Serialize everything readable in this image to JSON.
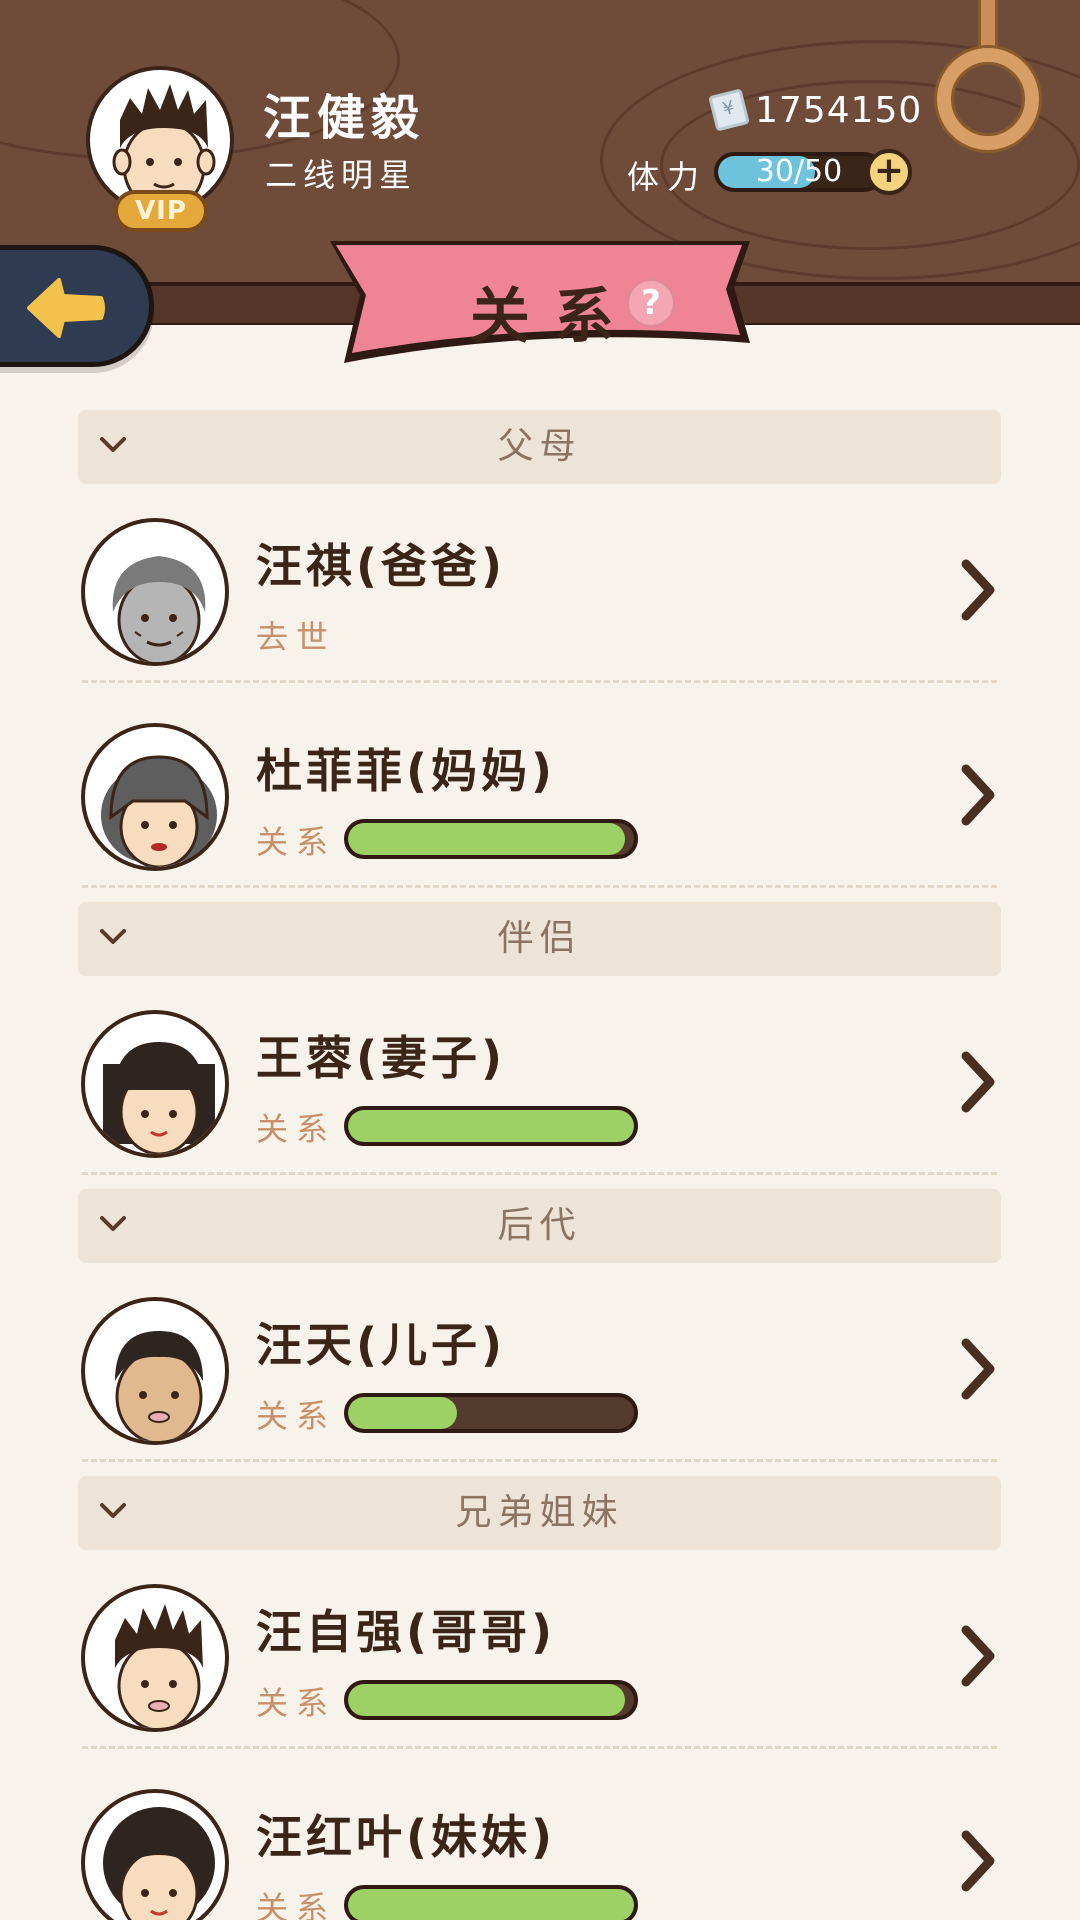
{
  "player": {
    "name": "汪健毅",
    "title": "二线明星",
    "vip": "VIP",
    "money": "1754150",
    "stamina_label": "体力",
    "stamina_text": "30/50",
    "stamina_fraction": 0.6
  },
  "page": {
    "title": "关系",
    "help": "?"
  },
  "sections": [
    {
      "title": "父母",
      "members": [
        {
          "name": "汪祺(爸爸)",
          "status": "去世",
          "relation": null,
          "face": "elder-male"
        },
        {
          "name": "杜菲菲(妈妈)",
          "status": "关系",
          "relation": 0.97,
          "face": "elder-female"
        }
      ]
    },
    {
      "title": "伴侣",
      "members": [
        {
          "name": "王蓉(妻子)",
          "status": "关系",
          "relation": 1.0,
          "face": "young-female"
        }
      ]
    },
    {
      "title": "后代",
      "members": [
        {
          "name": "汪天(儿子)",
          "status": "关系",
          "relation": 0.38,
          "face": "young-male"
        }
      ]
    },
    {
      "title": "兄弟姐妹",
      "members": [
        {
          "name": "汪自强(哥哥)",
          "status": "关系",
          "relation": 0.97,
          "face": "spiky-male"
        },
        {
          "name": "汪红叶(妹妹)",
          "status": "关系",
          "relation": 1.0,
          "face": "curly-female"
        }
      ]
    }
  ],
  "colors": {
    "header_wood": "#6f4b3a",
    "background": "#f7f3ea",
    "ribbon": "#f08497",
    "relation_fill": "#9dd165",
    "stamina_fill": "#6ec3dc"
  }
}
